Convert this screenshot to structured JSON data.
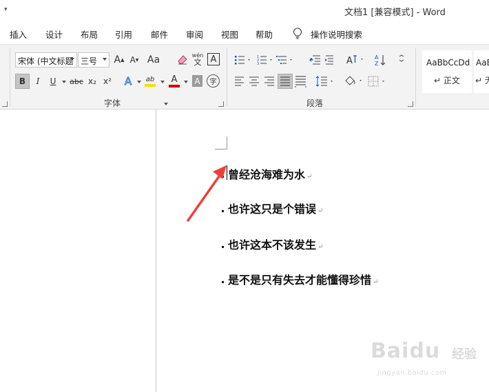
{
  "window": {
    "qat_arrow": "▾",
    "title": "文档1 [兼容模式]  -  Word"
  },
  "menu": {
    "tabs": [
      "插入",
      "设计",
      "布局",
      "引用",
      "邮件",
      "审阅",
      "视图",
      "帮助"
    ],
    "tell_me": "操作说明搜索"
  },
  "ribbon": {
    "font_group": {
      "label": "字体",
      "font_name": "宋体 (中文标题",
      "font_size": "三号",
      "grow_font": "A",
      "shrink_font": "A",
      "change_case": "Aa",
      "phonetic_top": "wén",
      "phonetic_bottom": "文",
      "char_border": "A",
      "bold": "B",
      "italic": "I",
      "underline": "U",
      "strikethrough": "abc",
      "subscript": "x₂",
      "superscript": "x²",
      "text_effects": "A",
      "highlight": "ab",
      "font_color": "A",
      "char_shading": "A",
      "enclose_char": "字"
    },
    "paragraph_group": {
      "label": "段落"
    },
    "styles_group": {
      "styles": [
        {
          "sample": "AaBbCcDd",
          "name": "正文"
        },
        {
          "sample": "AaB",
          "name": "无"
        }
      ]
    },
    "colors": {
      "highlight": "#f5e000",
      "font_color": "#d00000",
      "text_effect": "#2f6fc7"
    }
  },
  "document": {
    "paragraphs": [
      "曾经沧海难为水",
      "也许这只是个错误",
      "也许这本不该发生",
      "是不是只有失去才能懂得珍惜"
    ],
    "paragraph_mark": "↵",
    "arrow_color": "#e8413c"
  },
  "watermark": {
    "brand": "Baidu",
    "cn": "经验",
    "url": "jingyan.baidu.com"
  }
}
